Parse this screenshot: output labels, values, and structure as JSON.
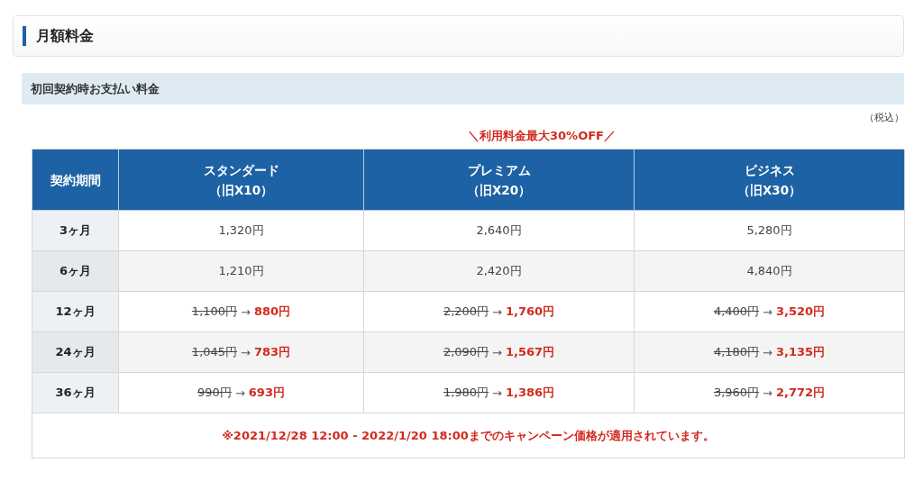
{
  "section_title": "月額料金",
  "subsection_title": "初回契約時お支払い料金",
  "tax_note": "（税込）",
  "campaign_banner": "＼利用料金最大30%OFF／",
  "table": {
    "columns": [
      {
        "lines": [
          "契約期間"
        ]
      },
      {
        "lines": [
          "スタンダード",
          "（旧X10）"
        ]
      },
      {
        "lines": [
          "プレミアム",
          "（旧X20）"
        ]
      },
      {
        "lines": [
          "ビジネス",
          "（旧X30）"
        ]
      }
    ],
    "rows": [
      {
        "cells": [
          {
            "kind": "period",
            "text": "3ヶ月"
          },
          {
            "kind": "plain",
            "price": "1,320円"
          },
          {
            "kind": "plain",
            "price": "2,640円"
          },
          {
            "kind": "plain",
            "price": "5,280円"
          }
        ]
      },
      {
        "cells": [
          {
            "kind": "period",
            "text": "6ヶ月"
          },
          {
            "kind": "plain",
            "price": "1,210円"
          },
          {
            "kind": "plain",
            "price": "2,420円"
          },
          {
            "kind": "plain",
            "price": "4,840円"
          }
        ]
      },
      {
        "cells": [
          {
            "kind": "period",
            "text": "12ヶ月"
          },
          {
            "kind": "discount",
            "old": "1,100円",
            "arrow": "→",
            "price": "880円"
          },
          {
            "kind": "discount",
            "old": "2,200円",
            "arrow": "→",
            "price": "1,760円"
          },
          {
            "kind": "discount",
            "old": "4,400円",
            "arrow": "→",
            "price": "3,520円"
          }
        ]
      },
      {
        "cells": [
          {
            "kind": "period",
            "text": "24ヶ月"
          },
          {
            "kind": "discount",
            "old": "1,045円",
            "arrow": "→",
            "price": "783円"
          },
          {
            "kind": "discount",
            "old": "2,090円",
            "arrow": "→",
            "price": "1,567円"
          },
          {
            "kind": "discount",
            "old": "4,180円",
            "arrow": "→",
            "price": "3,135円"
          }
        ]
      },
      {
        "cells": [
          {
            "kind": "period",
            "text": "36ヶ月"
          },
          {
            "kind": "discount",
            "old": "990円",
            "arrow": "→",
            "price": "693円"
          },
          {
            "kind": "discount",
            "old": "1,980円",
            "arrow": "→",
            "price": "1,386円"
          },
          {
            "kind": "discount",
            "old": "3,960円",
            "arrow": "→",
            "price": "2,772円"
          }
        ]
      }
    ],
    "footnote": "※2021/12/28 12:00 - 2022/1/20 18:00までのキャンペーン価格が適用されています。"
  }
}
